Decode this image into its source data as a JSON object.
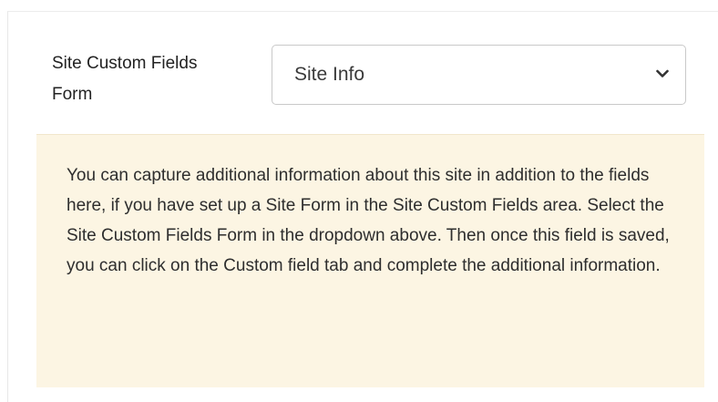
{
  "form": {
    "label": "Site Custom Fields Form",
    "select": {
      "value": "Site Info",
      "icon": "chevron-down-icon"
    }
  },
  "info": {
    "text": "You can capture additional information about this site in addition to the fields here, if you have set up a Site Form in the Site Custom Fields area. Select the Site Custom Fields Form in the dropdown above. Then once this field is saved, you can click on the Custom field tab and complete the additional information."
  },
  "colors": {
    "info_background": "#fcf5e3",
    "select_border": "#c9c9c9"
  }
}
